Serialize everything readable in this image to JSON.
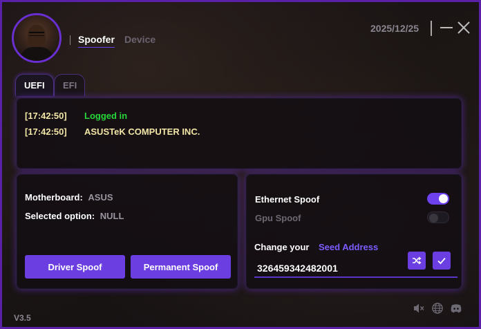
{
  "header": {
    "nav": [
      {
        "label": "Spoofer"
      },
      {
        "label": "Device"
      }
    ],
    "date": "2025/12/25",
    "window_buttons": [
      "minimize-icon",
      "close-icon"
    ]
  },
  "tabs": [
    {
      "label": "UEFI",
      "active": true
    },
    {
      "label": "EFI",
      "active": false
    }
  ],
  "log": [
    {
      "time": "[17:42:50]",
      "message": "Logged in",
      "color": "#27d63a"
    },
    {
      "time": "[17:42:50]",
      "message": "ASUSTeK COMPUTER INC.",
      "color": "#f2e6a6"
    }
  ],
  "info": {
    "motherboard_label": "Motherboard:",
    "motherboard_value": "ASUS",
    "selected_label": "Selected option:",
    "selected_value": "NULL",
    "driver_button": "Driver Spoof",
    "permanent_button": "Permanent Spoof"
  },
  "spoof": {
    "ethernet_label": "Ethernet Spoof",
    "ethernet_on": true,
    "gpu_label": "Gpu Spoof",
    "gpu_on": false,
    "seed_label": "Change your",
    "seed_accent": "Seed Address",
    "seed_value": "326459342482001",
    "buttons": [
      "shuffle-icon",
      "check-icon"
    ]
  },
  "footer": {
    "version": "V3.5",
    "icons": [
      "mute-icon",
      "globe-icon",
      "discord-icon"
    ]
  },
  "colors": {
    "accent": "#6a3ee0",
    "border": "#5a21a8",
    "success": "#27d63a",
    "warning": "#f2e6a6",
    "seed_accent": "#7d5cff"
  }
}
